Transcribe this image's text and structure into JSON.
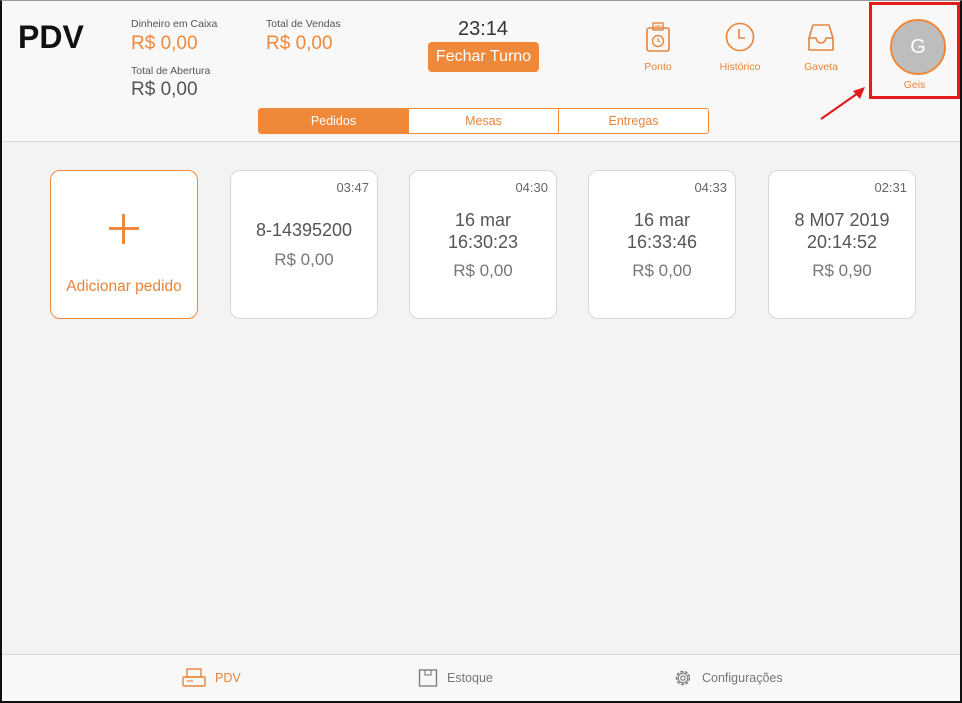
{
  "header": {
    "title": "PDV",
    "cash_label": "Dinheiro em Caixa",
    "cash_value": "R$ 0,00",
    "sales_label": "Total de Vendas",
    "sales_value": "R$ 0,00",
    "opening_label": "Total de Abertura",
    "opening_value": "R$ 0,00",
    "time": "23:14",
    "close_shift_label": "Fechar Turno",
    "tools": [
      {
        "label": "Ponto",
        "icon": "timeclock-icon"
      },
      {
        "label": "Histórico",
        "icon": "clock-icon"
      },
      {
        "label": "Gaveta",
        "icon": "drawer-icon"
      }
    ],
    "user": {
      "initial": "G",
      "name": "Geis"
    }
  },
  "tabs": [
    {
      "label": "Pedidos",
      "active": true
    },
    {
      "label": "Mesas",
      "active": false
    },
    {
      "label": "Entregas",
      "active": false
    }
  ],
  "add_order_label": "Adicionar pedido",
  "orders": [
    {
      "time": "03:47",
      "name": "8-14395200",
      "price": "R$ 0,00"
    },
    {
      "time": "04:30",
      "name": "16 mar\n16:30:23",
      "price": "R$ 0,00"
    },
    {
      "time": "04:33",
      "name": "16 mar\n16:33:46",
      "price": "R$ 0,00"
    },
    {
      "time": "02:31",
      "name": "8 M07 2019\n20:14:52",
      "price": "R$ 0,90"
    }
  ],
  "bottom_nav": [
    {
      "label": "PDV",
      "icon": "register-icon",
      "active": true
    },
    {
      "label": "Estoque",
      "icon": "box-icon",
      "active": false
    },
    {
      "label": "Configurações",
      "icon": "gear-icon",
      "active": false
    }
  ],
  "colors": {
    "accent": "#f0883a",
    "highlight": "#e31b1b"
  }
}
